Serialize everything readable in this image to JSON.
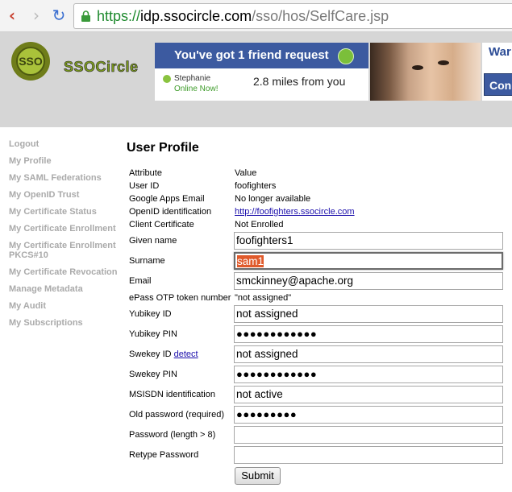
{
  "browser": {
    "url_scheme": "https://",
    "url_host": "idp.ssocircle.com",
    "url_path": "/sso/hos/SelfCare.jsp"
  },
  "header": {
    "logo_mark": "SSO",
    "logo_text": "SSOCircle",
    "ad": {
      "headline": "You've got 1 friend request",
      "friend_name": "Stephanie",
      "friend_status": "Online Now!",
      "distance": "2.8 miles from you",
      "right_top": "War",
      "right_button": "Con"
    }
  },
  "sidebar": {
    "items": [
      {
        "label": "Logout"
      },
      {
        "label": "My Profile"
      },
      {
        "label": "My SAML Federations"
      },
      {
        "label": "My OpenID Trust"
      },
      {
        "label": "My Certificate Status"
      },
      {
        "label": "My Certificate Enrollment"
      },
      {
        "label": "My Certificate Enrollment PKCS#10"
      },
      {
        "label": "My Certificate Revocation"
      },
      {
        "label": "Manage Metadata"
      },
      {
        "label": "My Audit"
      },
      {
        "label": "My Subscriptions"
      }
    ]
  },
  "main": {
    "title": "User Profile",
    "header_attribute": "Attribute",
    "header_value": "Value",
    "user_id_label": "User ID",
    "user_id_value": "foofighters",
    "google_label": "Google Apps Email",
    "google_value": "No longer available",
    "openid_label": "OpenID identification",
    "openid_value": "http://foofighters.ssocircle.com",
    "client_cert_label": "Client Certificate",
    "client_cert_value": "Not Enrolled",
    "given_name_label": "Given name",
    "given_name_value": "foofighters1",
    "surname_label": "Surname",
    "surname_value": "sam1",
    "email_label": "Email",
    "email_value": "smckinney@apache.org",
    "epass_label": "ePass OTP token number",
    "epass_value": "\"not assigned\"",
    "yubikey_id_label": "Yubikey ID",
    "yubikey_id_value": "not assigned",
    "yubikey_pin_label": "Yubikey PIN",
    "yubikey_pin_value": "●●●●●●●●●●●●",
    "swekey_id_label": "Swekey ID",
    "swekey_detect": "detect",
    "swekey_id_value": "not assigned",
    "swekey_pin_label": "Swekey PIN",
    "swekey_pin_value": "●●●●●●●●●●●●",
    "msisdn_label": "MSISDN identification",
    "msisdn_value": "not active",
    "old_pw_label": "Old password (required)",
    "old_pw_value": "●●●●●●●●●",
    "new_pw_label": "Password (length > 8)",
    "new_pw_value": "",
    "retype_pw_label": "Retype Password",
    "retype_pw_value": "",
    "submit_label": "Submit"
  },
  "colors": {
    "logo_green": "#7d9c1e",
    "ad_blue": "#3c5aa0",
    "selection": "#e05a2b",
    "sidebar_text": "#aaaaaa"
  }
}
